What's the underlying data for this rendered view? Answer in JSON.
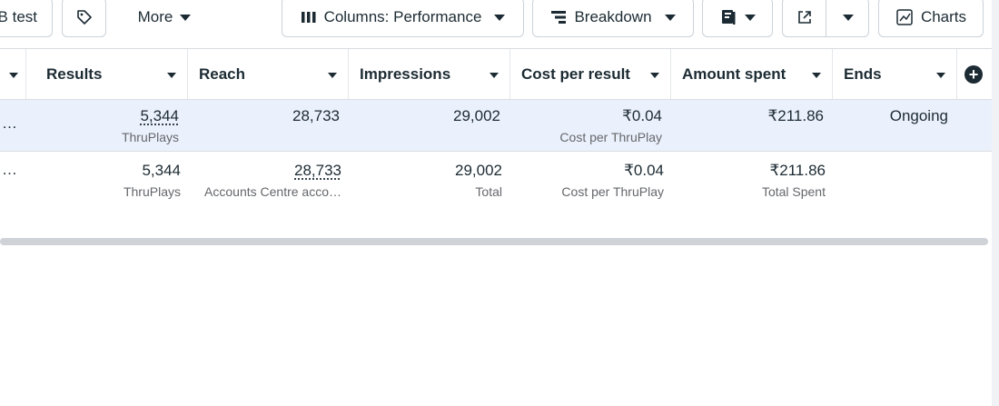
{
  "toolbar": {
    "test_label": "B test",
    "more_label": "More",
    "columns_label": "Columns: Performance",
    "breakdown_label": "Breakdown",
    "charts_label": "Charts"
  },
  "table": {
    "headers": [
      "Results",
      "Reach",
      "Impressions",
      "Cost per result",
      "Amount spent",
      "Ends"
    ],
    "rows": [
      {
        "leading": "…",
        "results": "5,344",
        "results_sub": "ThruPlays",
        "reach": "28,733",
        "reach_sub": "",
        "impressions": "29,002",
        "impressions_sub": "",
        "cost": "₹0.04",
        "cost_sub": "Cost per ThruPlay",
        "spent": "₹211.86",
        "spent_sub": "",
        "ends": "Ongoing"
      },
      {
        "leading": "…",
        "results": "5,344",
        "results_sub": "ThruPlays",
        "reach": "28,733",
        "reach_sub": "Accounts Centre acco…",
        "impressions": "29,002",
        "impressions_sub": "Total",
        "cost": "₹0.04",
        "cost_sub": "Cost per ThruPlay",
        "spent": "₹211.86",
        "spent_sub": "Total Spent",
        "ends": ""
      }
    ]
  },
  "icons": {
    "tag": "tag-icon",
    "columns": "columns-icon",
    "breakdown": "breakdown-icon",
    "reports": "reports-icon",
    "export": "export-icon",
    "charts": "chart-icon",
    "add_column": "plus-circle-icon"
  }
}
